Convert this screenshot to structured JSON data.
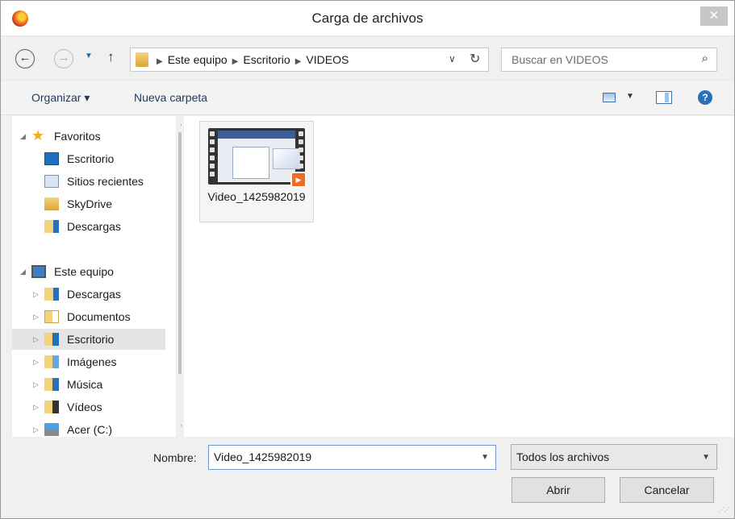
{
  "window": {
    "title": "Carga de archivos",
    "close_glyph": "✕"
  },
  "address_bar": {
    "crumbs": [
      "Este equipo",
      "Escritorio",
      "VIDEOS"
    ]
  },
  "search": {
    "placeholder": "Buscar en VIDEOS"
  },
  "toolbar": {
    "organize_label": "Organizar ▾",
    "new_folder_label": "Nueva carpeta"
  },
  "nav_tree": {
    "favorites": {
      "label": "Favoritos",
      "items": [
        "Escritorio",
        "Sitios recientes",
        "SkyDrive",
        "Descargas"
      ]
    },
    "this_pc": {
      "label": "Este equipo",
      "items": [
        "Descargas",
        "Documentos",
        "Escritorio",
        "Imágenes",
        "Música",
        "Vídeos",
        "Acer (C:)"
      ],
      "selected": "Escritorio"
    }
  },
  "files": [
    {
      "name": "Video_1425982019",
      "type": "video"
    }
  ],
  "filename_field": {
    "label": "Nombre:",
    "value": "Video_1425982019"
  },
  "file_type_filter": {
    "value": "Todos los archivos"
  },
  "buttons": {
    "open": "Abrir",
    "cancel": "Cancelar"
  },
  "colors": {
    "accent": "#2b6fb6",
    "selected_bg": "#e5e5e5",
    "close_bg": "#c7c7c7"
  }
}
